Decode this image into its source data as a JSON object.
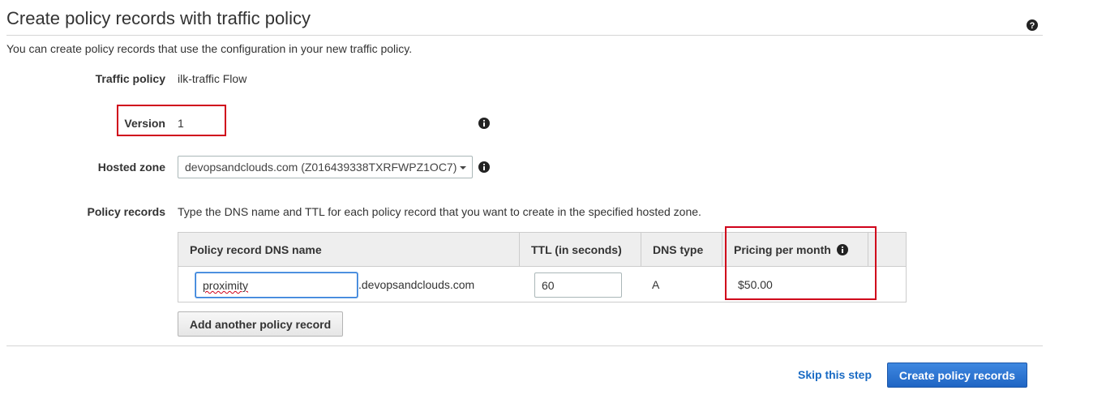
{
  "header": {
    "title": "Create policy records with traffic policy",
    "subtitle": "You can create policy records that use the configuration in your new traffic policy."
  },
  "form": {
    "traffic_policy": {
      "label": "Traffic policy",
      "value": "ilk-traffic Flow"
    },
    "version": {
      "label": "Version",
      "value": "1"
    },
    "hosted_zone": {
      "label": "Hosted zone",
      "selected": "devopsandclouds.com (Z016439338TXRFWPZ1OC7)"
    },
    "policy_records": {
      "label": "Policy records",
      "description": "Type the DNS name and TTL for each policy record that you want to create in the specified hosted zone."
    }
  },
  "table": {
    "columns": [
      "Policy record DNS name",
      "TTL (in seconds)",
      "DNS type",
      "Pricing per month"
    ],
    "rows": [
      {
        "dns_name": "proximity",
        "domain_suffix": ".devopsandclouds.com",
        "ttl": "60",
        "dns_type": "A",
        "pricing": "$50.00"
      }
    ]
  },
  "buttons": {
    "add_record": "Add another policy record",
    "skip": "Skip this step",
    "create": "Create policy records"
  },
  "icons": {
    "help": "help-circle-icon",
    "info": "info-circle-icon"
  },
  "colors": {
    "primary": "#1f65c4",
    "link": "#1a6bc4",
    "highlight_box": "#d0021b"
  }
}
